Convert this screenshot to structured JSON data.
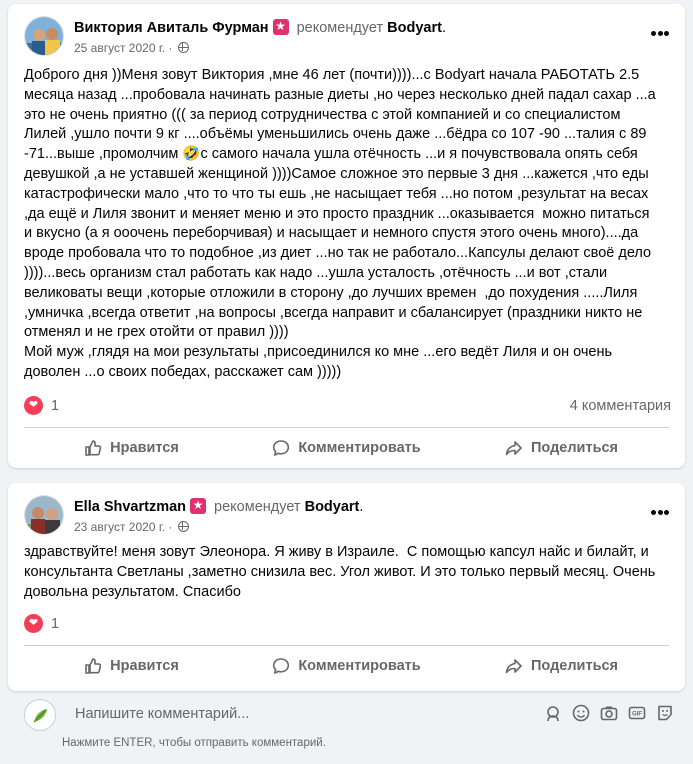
{
  "posts": [
    {
      "author": "Виктория Авиталь Фурман",
      "recommends": "рекомендует",
      "page": "Bodyart",
      "date": "25 август 2020 г.",
      "text": "Доброго дня ))Меня зовут Виктория ,мне 46 лет (почти))))...с Bodyart начала РАБОТАТЬ 2.5\nмесяца назад ...пробовала начинать разные диеты ,но через несколько дней падал сахар ...а\nэто не очень приятно ((( за период сотрудничества с этой компанией и со специалистом\nЛилей ,ушло почти 9 кг ....объёмы уменьшились очень даже ...бёдра со 107 -90 ...талия с 89\n-71...выше ,промолчим 🤣с самого начала ушла отёчность ...и я почувствовала опять себя\nдевушкой ,а не уставшей женщиной ))))Самое сложное это первые 3 дня ...кажется ,что еды\nкатастрофически мало ,что то что ты ешь ,не насыщает тебя ...но потом ,результат на весах\n,да ещё и Лиля звонит и меняет меню и это просто праздник ...оказывается  можно питаться\nи вкусно (а я ооочень переборчивая) и насыщает и немного спустя этого очень много)....да\nвроде пробовала что то подобное ,из диет ...но так не работало...Капсулы делают своё дело\n))))...весь организм стал работать как надо ...ушла усталость ,отёчность ...и вот ,стали\nвеликоваты вещи ,которые отложили в сторону ,до лучших времен  ,до похудения .....Лиля\n,умничка ,всегда ответит ,на вопросы ,всегда направит и сбалансирует (праздники никто не\nотменял и не грех отойти от правил ))))\nМой муж ,глядя на мои результаты ,присоединился ко мне ...его ведёт Лиля и он очень\nдоволен ...о своих победах, расскажет сам )))))",
      "reactions": "1",
      "comments": "4 комментария"
    },
    {
      "author": "Ella Shvartzman",
      "recommends": "рекомендует",
      "page": "Bodyart",
      "date": "23 август 2020 г.",
      "text": "здравствуйте! меня зовут Элеонора. Я живу в Израиле.  С помощью капсул найс и билайт, и\nконсультанта Светланы ,заметно снизила вес. Угол живот. И это только первый месяц. Очень\nдовольна результатом. Спасибо",
      "reactions": "1",
      "comments": ""
    }
  ],
  "actions": {
    "like": "Нравится",
    "comment": "Комментировать",
    "share": "Поделиться"
  },
  "comment_box": {
    "placeholder": "Напишите комментарий...",
    "hint": "Нажмите ENTER, чтобы отправить комментарий."
  },
  "colors": {
    "accent_badge": "#e1306c",
    "love_reaction": "#f33e58",
    "secondary_text": "#65676b"
  }
}
